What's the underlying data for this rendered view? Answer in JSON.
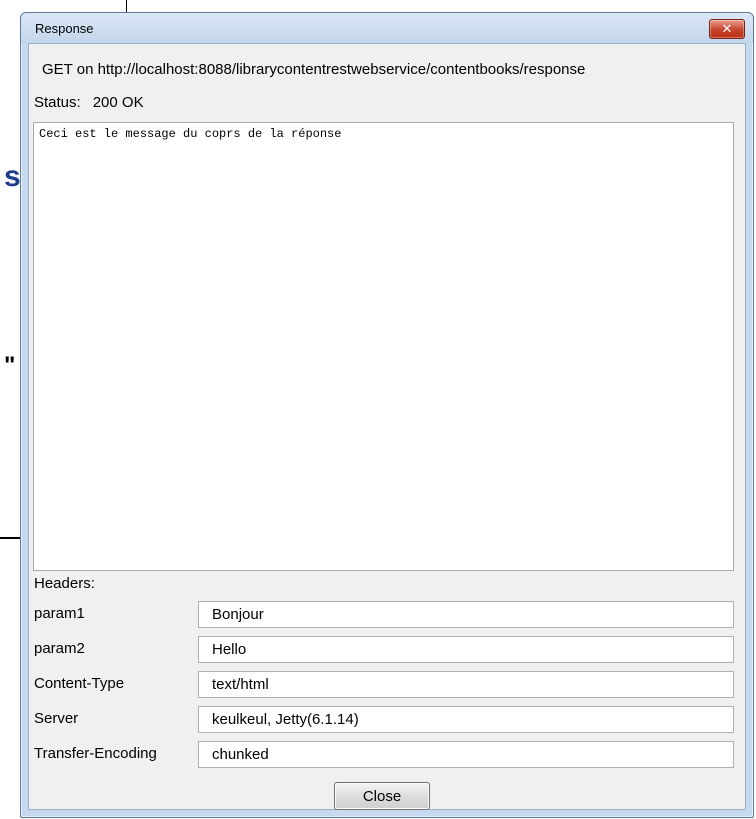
{
  "background": {
    "glyph_s": "s",
    "glyph_quote": "\""
  },
  "window": {
    "title": "Response",
    "close_glyph": "✕"
  },
  "request": {
    "text": "GET on http://localhost:8088/librarycontentrestwebservice/contentbooks/response"
  },
  "status": {
    "label": "Status:",
    "value": "200 OK"
  },
  "body": {
    "content": "Ceci est le message du coprs de la réponse"
  },
  "headers": {
    "label": "Headers:",
    "rows": [
      {
        "name": "param1",
        "value": "Bonjour"
      },
      {
        "name": "param2",
        "value": "Hello"
      },
      {
        "name": "Content-Type",
        "value": "text/html"
      },
      {
        "name": "Server",
        "value": "keulkeul, Jetty(6.1.14)"
      },
      {
        "name": "Transfer-Encoding",
        "value": "chunked"
      }
    ]
  },
  "buttons": {
    "close_label": "Close"
  },
  "colors": {
    "window_frame": "#c6d9ee",
    "client_bg": "#f0f0f0",
    "close_button_red": "#c7422b",
    "background_glyph_blue": "#1f3d8a"
  }
}
